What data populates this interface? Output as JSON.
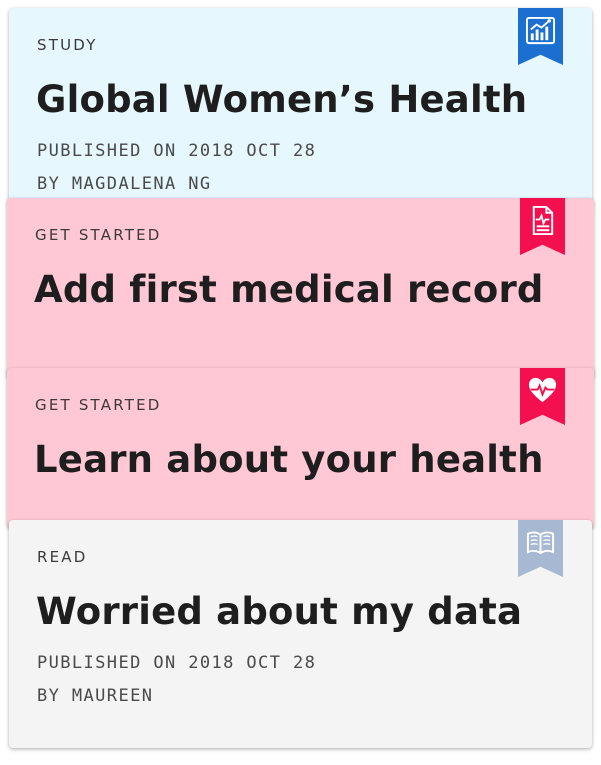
{
  "colors": {
    "study_bg": "#e6f7fd",
    "study_ribbon": "#1a6fd1",
    "getstarted_bg": "#ffc8d4",
    "getstarted_ribbon": "#f40f4f",
    "read_bg": "#f4f4f4",
    "read_ribbon": "#a6b8d2"
  },
  "cards": [
    {
      "category": "STUDY",
      "title": "Global Women’s Health",
      "published": "PUBLISHED ON 2018 OCT 28",
      "author": "BY MAGDALENA NG",
      "icon": "bar-chart-icon"
    },
    {
      "category": "GET STARTED",
      "title": "Add first medical record",
      "icon": "document-icon"
    },
    {
      "category": "GET STARTED",
      "title": "Learn about your health",
      "icon": "heart-pulse-icon"
    },
    {
      "category": "READ",
      "title": "Worried about my data",
      "published": "PUBLISHED ON 2018 OCT 28",
      "author": "BY MAUREEN",
      "icon": "open-book-icon"
    }
  ]
}
